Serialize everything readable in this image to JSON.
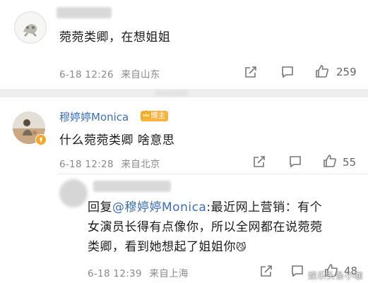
{
  "comment1": {
    "text": "菀菀类卿，在想姐姐",
    "date": "6-18 12:26",
    "location": "来自山东",
    "like_count": "259"
  },
  "comment2": {
    "username": "穆婷婷Monica",
    "badge": "博主",
    "text": "什么菀菀类卿 啥意思",
    "date": "6-18 12:28",
    "location": "来自北京",
    "like_count": "55"
  },
  "reply": {
    "prefix": "回复",
    "mention": "@穆婷婷Monica",
    "text_line1": ":最近网上营销：有个",
    "text_line2": "女演员长得有点像你，所以全网都在说菀菀",
    "text_line3": "类卿，看到她想起了姐姐你",
    "emoji": "😼",
    "date": "6-18 12:39",
    "location": "来自上海",
    "like_count": "48"
  },
  "watermark": "娱乐头条小咖",
  "colors": {
    "link": "#3a6fb7",
    "badge": "#f7b33b",
    "meta_gray": "#8a8a8a"
  }
}
